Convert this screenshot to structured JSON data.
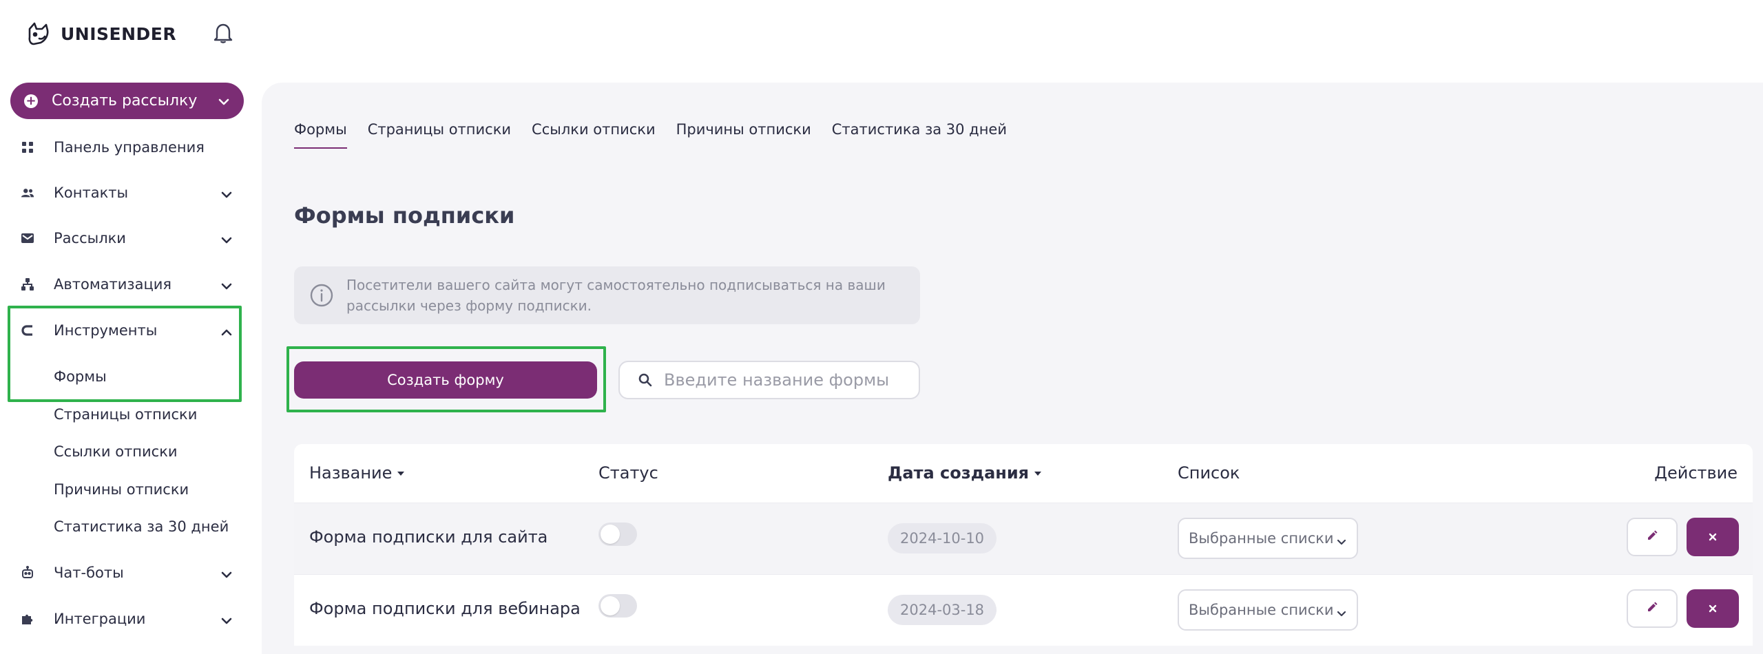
{
  "brand": {
    "name": "UNISENDER"
  },
  "sidebar": {
    "create_label": "Создать рассылку",
    "items": [
      {
        "label": "Панель управления"
      },
      {
        "label": "Контакты"
      },
      {
        "label": "Рассылки"
      },
      {
        "label": "Автоматизация"
      },
      {
        "label": "Инструменты"
      },
      {
        "label": "Чат-боты"
      },
      {
        "label": "Интеграции"
      }
    ],
    "tools_sub": [
      {
        "label": "Формы"
      },
      {
        "label": "Страницы отписки"
      },
      {
        "label": "Ссылки отписки"
      },
      {
        "label": "Причины отписки"
      },
      {
        "label": "Статистика за 30 дней"
      }
    ]
  },
  "tabs": [
    {
      "label": "Формы"
    },
    {
      "label": "Страницы отписки"
    },
    {
      "label": "Ссылки отписки"
    },
    {
      "label": "Причины отписки"
    },
    {
      "label": "Статистика за 30 дней"
    }
  ],
  "main": {
    "title": "Формы подписки",
    "info": "Посетители вашего сайта могут самостоятельно подписываться на ваши рассылки через форму подписки.",
    "create_form_label": "Создать форму",
    "search_placeholder": "Введите название формы"
  },
  "table": {
    "headers": {
      "name": "Название",
      "status": "Статус",
      "date": "Дата создания",
      "list": "Список",
      "action": "Действие"
    },
    "rows": [
      {
        "name": "Форма подписки для сайта",
        "date": "2024-10-10",
        "list": "Выбранные списки"
      },
      {
        "name": "Форма подписки для вебинара",
        "date": "2024-03-18",
        "list": "Выбранные списки"
      }
    ]
  },
  "colors": {
    "accent": "#7b2d74",
    "highlight": "#2fb24c",
    "main_bg": "#f5f5f8"
  }
}
